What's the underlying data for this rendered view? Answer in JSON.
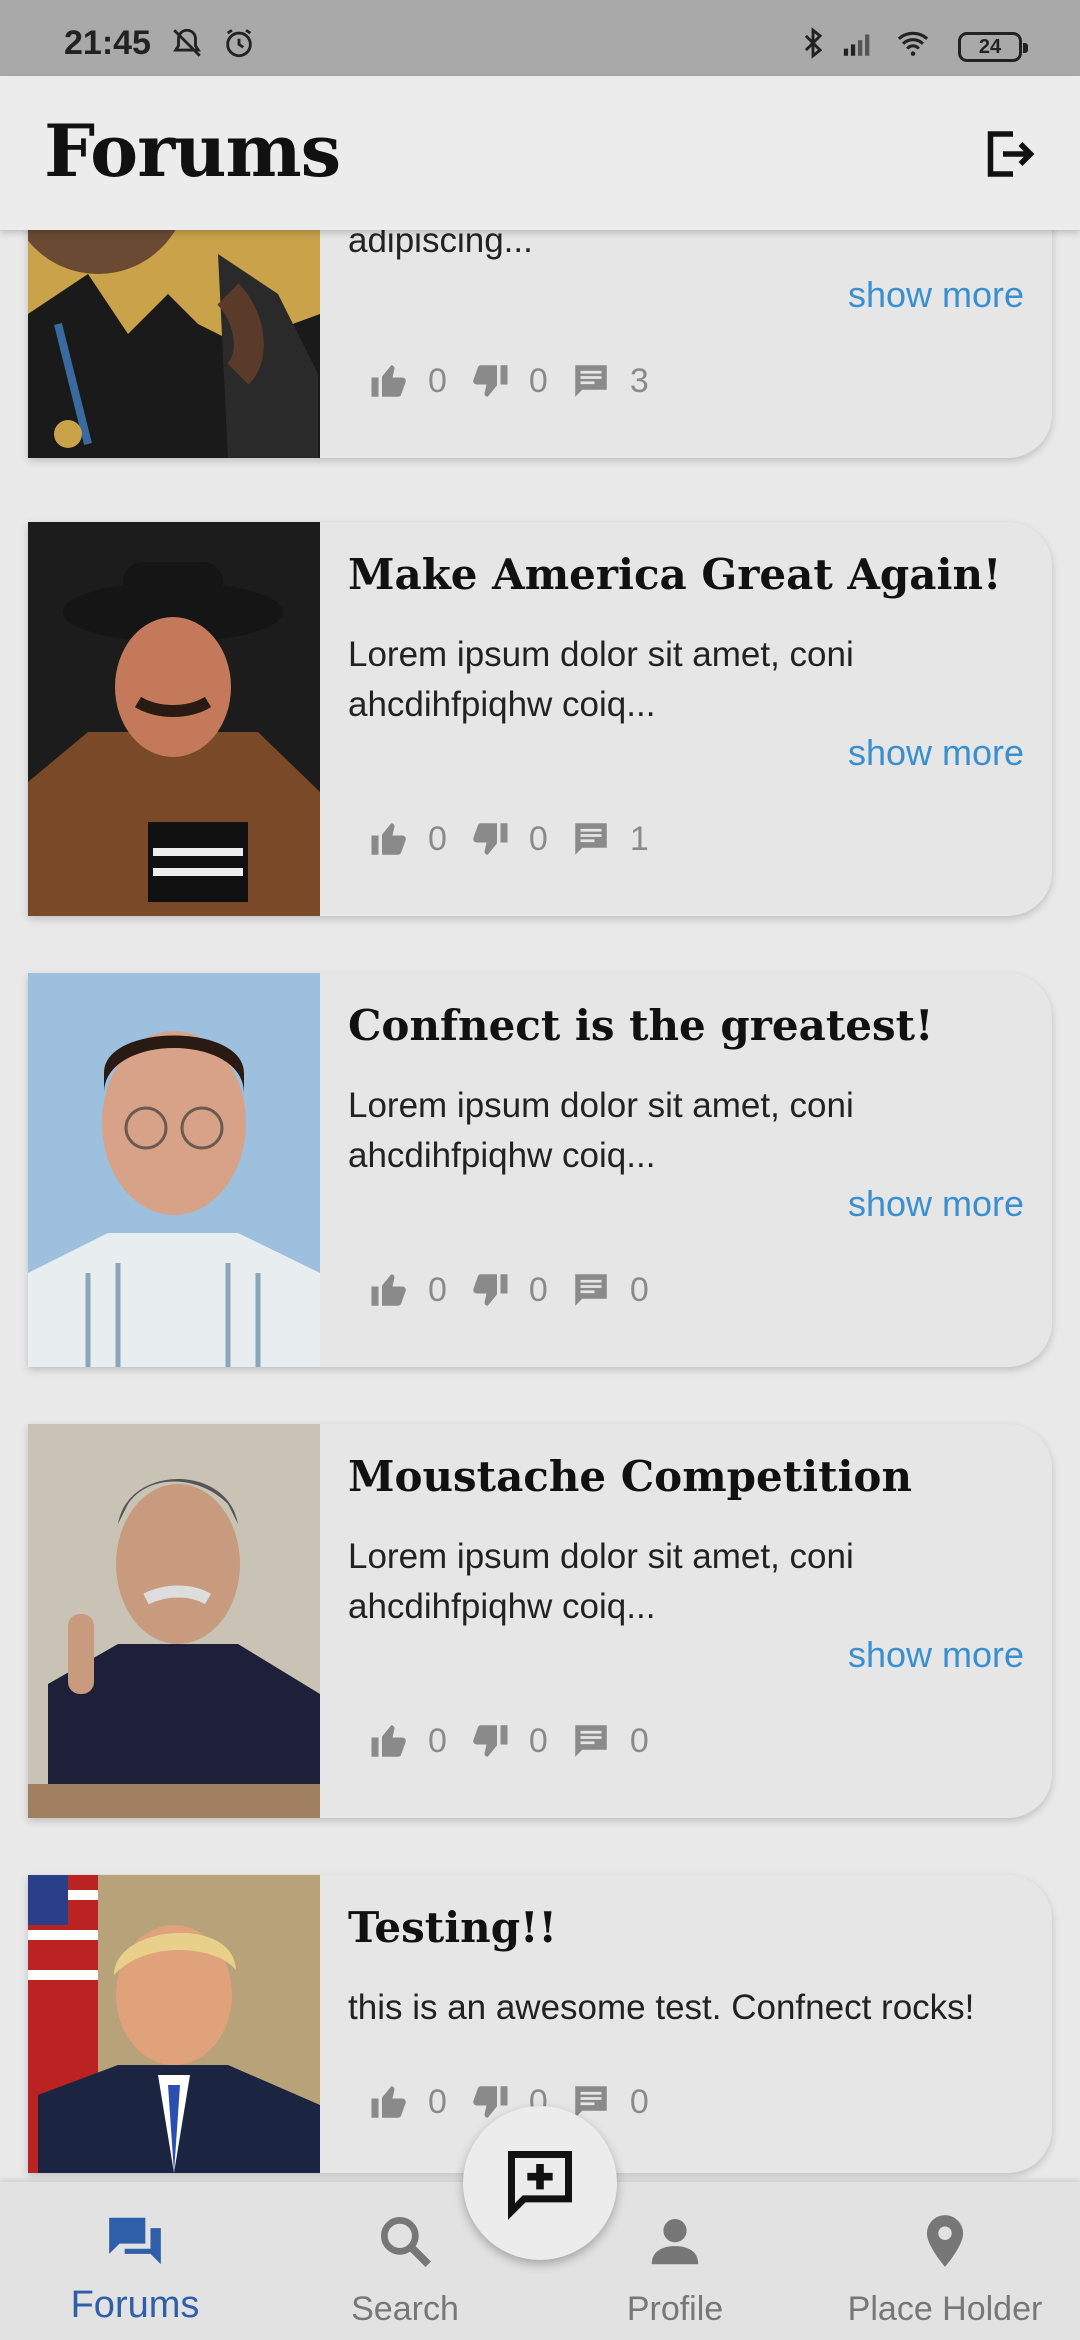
{
  "status_bar": {
    "time": "21:45",
    "battery": "24"
  },
  "app_bar": {
    "title": "Forums"
  },
  "posts": [
    {
      "title": "",
      "description": "adipiscing...",
      "show_more": "show more",
      "likes": "0",
      "dislikes": "0",
      "comments": "3",
      "image": "man-with-medal-photo"
    },
    {
      "title": "Make America Great Again!",
      "description": "Lorem ipsum dolor sit amet, coni ahcdihfpiqhw coiq...",
      "show_more": "show more",
      "likes": "0",
      "dislikes": "0",
      "comments": "1",
      "image": "man-with-cowboy-hat-accordion-photo"
    },
    {
      "title": "Confnect is the greatest!",
      "description": "Lorem ipsum dolor sit amet, coni ahcdihfpiqhw coiq...",
      "show_more": "show more",
      "likes": "0",
      "dislikes": "0",
      "comments": "0",
      "image": "man-with-glasses-photo"
    },
    {
      "title": "Moustache Competition",
      "description": "Lorem ipsum dolor sit amet, coni ahcdihfpiqhw coiq...",
      "show_more": "show more",
      "likes": "0",
      "dislikes": "0",
      "comments": "0",
      "image": "man-with-moustache-photo"
    },
    {
      "title": "Testing!!",
      "description": "this is an awesome test. Confnect rocks!",
      "show_more": "",
      "likes": "0",
      "dislikes": "0",
      "comments": "0",
      "image": "man-in-suit-with-flag-photo"
    }
  ],
  "bottom_nav": {
    "items": [
      {
        "label": "Forums",
        "icon": "forum-icon",
        "active": true
      },
      {
        "label": "Search",
        "icon": "search-icon",
        "active": false
      },
      {
        "label": "Profile",
        "icon": "person-icon",
        "active": false
      },
      {
        "label": "Place Holder",
        "icon": "location-pin-icon",
        "active": false
      }
    ]
  },
  "fab": {
    "icon": "add-comment-icon"
  },
  "colors": {
    "accent": "#2f5fa8",
    "link": "#3a8fd0",
    "stat": "#8a8a8a",
    "background": "#e9e9e9"
  }
}
